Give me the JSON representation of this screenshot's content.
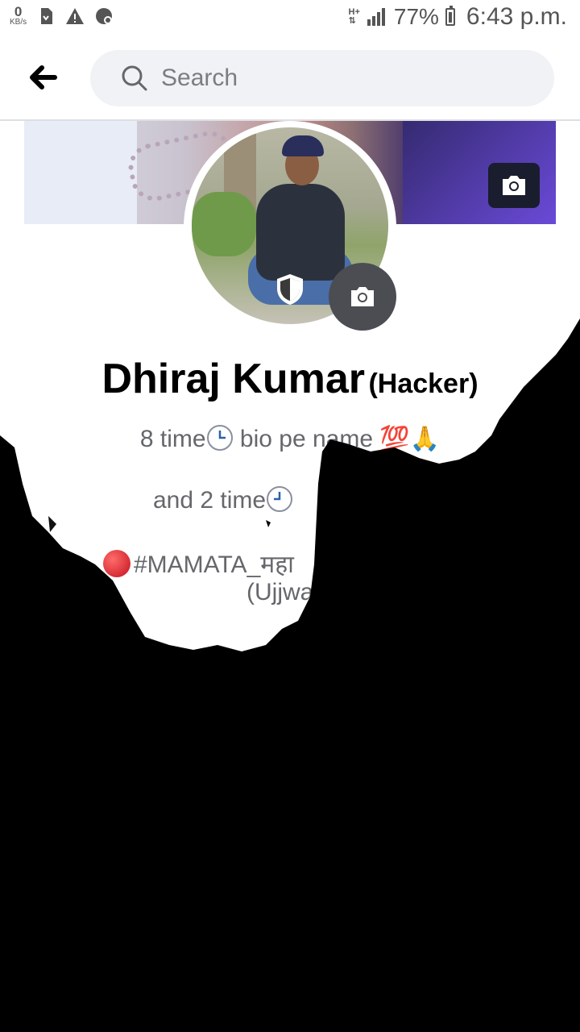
{
  "status_bar": {
    "data_rate": "0",
    "data_rate_unit": "KB/s",
    "network_type": "H+",
    "battery": "77%",
    "time": "6:43 p.m."
  },
  "header": {
    "search_placeholder": "Search"
  },
  "profile": {
    "name": "Dhiraj Kumar",
    "name_tag": "(Hacker)",
    "bio_line1": "8 time",
    "bio_line1_b": " bio pe name ",
    "bio_line1_emoji": "💯🙏",
    "bio_line2": "and 2 time",
    "bio_line3": "#MAMATA_महा",
    "bio_line4": "(Ujjwa"
  },
  "icons": {
    "back": "arrow-left-icon",
    "search": "search-icon",
    "cover_camera": "camera-icon",
    "avatar_camera": "camera-icon",
    "shield": "shield-icon"
  }
}
